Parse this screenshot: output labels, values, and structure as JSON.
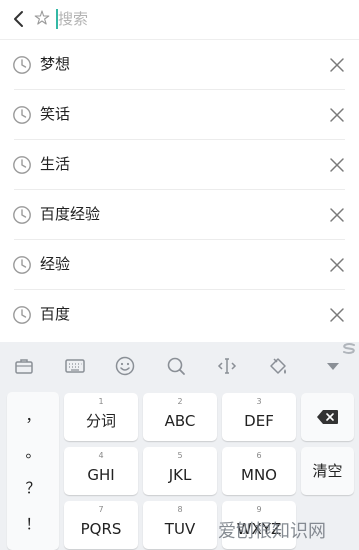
{
  "search": {
    "placeholder": "搜索",
    "value": ""
  },
  "history": {
    "items": [
      {
        "label": "梦想"
      },
      {
        "label": "笑话"
      },
      {
        "label": "生活"
      },
      {
        "label": "百度经验"
      },
      {
        "label": "经验"
      },
      {
        "label": "百度"
      }
    ]
  },
  "keyboard": {
    "punctuation": [
      "，",
      "。",
      "？",
      "！"
    ],
    "keys": [
      {
        "num": "1",
        "label": "分词"
      },
      {
        "num": "2",
        "label": "ABC"
      },
      {
        "num": "3",
        "label": "DEF"
      },
      {
        "num": "4",
        "label": "GHI"
      },
      {
        "num": "5",
        "label": "JKL"
      },
      {
        "num": "6",
        "label": "MNO"
      },
      {
        "num": "7",
        "label": "PQRS"
      },
      {
        "num": "8",
        "label": "TUV"
      },
      {
        "num": "9",
        "label": "WXYZ"
      }
    ],
    "clear_label": "清空",
    "toolbar_icons": [
      "briefcase-icon",
      "keyboard-icon",
      "emoji-icon",
      "search-icon",
      "cursor-move-icon",
      "paint-bucket-icon",
      "collapse-icon"
    ]
  },
  "watermark": {
    "text": "爱刨根知识网"
  },
  "colors": {
    "accent": "#33b8a5",
    "keyboard_bg": "#eef0f3",
    "icon_gray": "#8a8f96"
  }
}
